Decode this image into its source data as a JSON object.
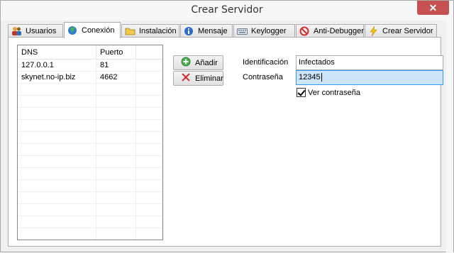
{
  "window": {
    "title": "Crear Servidor",
    "close_glyph": "✕"
  },
  "tabs": [
    {
      "label": "Usuarios",
      "icon": "users-icon"
    },
    {
      "label": "Conexión",
      "icon": "globe-icon",
      "active": true
    },
    {
      "label": "Instalación",
      "icon": "folder-icon"
    },
    {
      "label": "Mensaje",
      "icon": "info-icon"
    },
    {
      "label": "Keylogger",
      "icon": "keyboard-icon"
    },
    {
      "label": "Anti-Debugger",
      "icon": "forbidden-icon"
    },
    {
      "label": "Crear Servidor",
      "icon": "lightning-icon"
    }
  ],
  "connections": {
    "headers": [
      "DNS",
      "Puerto"
    ],
    "rows": [
      [
        "127.0.0.1",
        "81"
      ],
      [
        "skynet.no-ip.biz",
        "4662"
      ]
    ]
  },
  "buttons": {
    "add": "Añadir",
    "remove": "Eliminar"
  },
  "form": {
    "id_label": "Identificación",
    "id_value": "Infectados",
    "pw_label": "Contraseña",
    "pw_value": "12345",
    "show_pw_label": "Ver contraseña",
    "show_pw_checked": true
  },
  "colors": {
    "close": "#c75050",
    "selection": "#cce4f7",
    "focus": "#3399ff"
  }
}
